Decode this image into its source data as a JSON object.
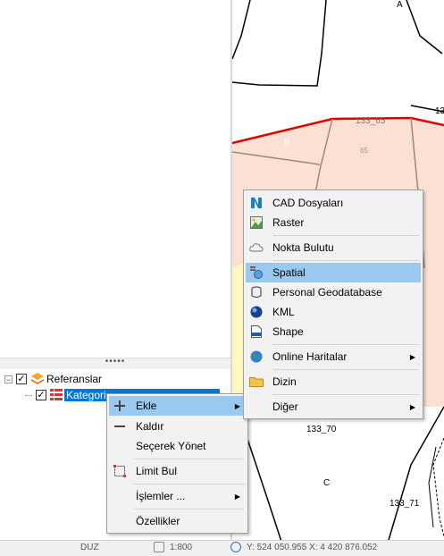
{
  "tree": {
    "expander_glyph": "−",
    "check_glyph": "✓",
    "splitter_grip": "•••••",
    "root_label": "Referanslar",
    "child_label": "Kategori"
  },
  "map": {
    "labels": {
      "a": "A",
      "parcel_top": "133_65",
      "parcel_right": "13",
      "b": "B",
      "small": "65",
      "parcel_70": "133_70",
      "c": "C",
      "parcel_71": "133_71"
    }
  },
  "status": {
    "mode": "DUZ",
    "scale": "1:800",
    "coords": "Y: 524 050.955 X: 4 420 876.052"
  },
  "context_menu": {
    "items": [
      {
        "label": "Ekle",
        "icon": "plus-icon",
        "submenu": true
      },
      {
        "label": "Kaldır",
        "icon": "minus-icon"
      },
      {
        "label": "Seçerek Yönet",
        "icon": ""
      },
      {
        "label": "Limit Bul",
        "icon": "extent-icon"
      },
      {
        "label": "İşlemler ...",
        "icon": "",
        "submenu": true
      },
      {
        "label": "Özellikler",
        "icon": ""
      }
    ]
  },
  "submenu": {
    "items": [
      {
        "label": "CAD Dosyaları",
        "icon": "cad-icon"
      },
      {
        "label": "Raster",
        "icon": "raster-icon"
      },
      {
        "label": "Nokta Bulutu",
        "icon": "cloud-icon"
      },
      {
        "label": "Spatial",
        "icon": "spatial-icon"
      },
      {
        "label": "Personal Geodatabase",
        "icon": "database-icon"
      },
      {
        "label": "KML",
        "icon": "kml-icon"
      },
      {
        "label": "Shape",
        "icon": "shape-file-icon"
      },
      {
        "label": "Online Haritalar",
        "icon": "globe-icon",
        "submenu": true
      },
      {
        "label": "Dizin",
        "icon": "folder-icon"
      },
      {
        "label": "Diğer",
        "icon": "",
        "submenu": true
      }
    ]
  },
  "arrow_glyph": "▶",
  "colors": {
    "highlight": "#99c9ef",
    "selection": "#0078d7",
    "parcel_fill": "#fbe1d4",
    "boundary_red": "#e00000"
  }
}
